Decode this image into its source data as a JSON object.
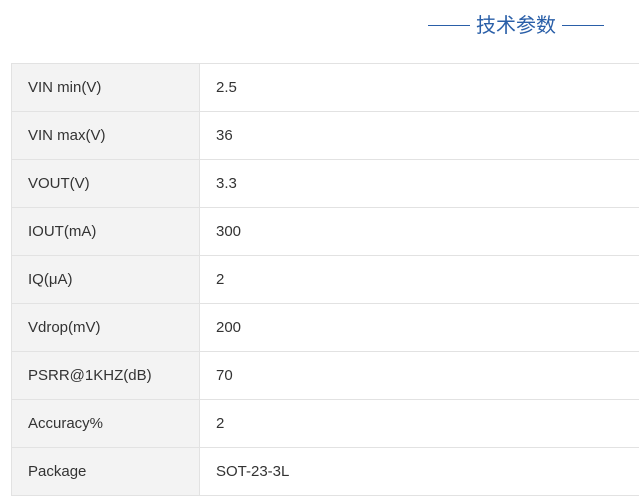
{
  "header": {
    "title": "技术参数",
    "accent_color": "#2a5fa8"
  },
  "specs": [
    {
      "label": "VIN min(V)",
      "value": "2.5"
    },
    {
      "label": "VIN max(V)",
      "value": "36"
    },
    {
      "label": "VOUT(V)",
      "value": "3.3"
    },
    {
      "label": "IOUT(mA)",
      "value": "300"
    },
    {
      "label": "IQ(μA)",
      "value": "2"
    },
    {
      "label": "Vdrop(mV)",
      "value": "200"
    },
    {
      "label": "PSRR@1KHZ(dB)",
      "value": "70"
    },
    {
      "label": "Accuracy%",
      "value": "2"
    },
    {
      "label": "Package",
      "value": "SOT-23-3L"
    }
  ]
}
